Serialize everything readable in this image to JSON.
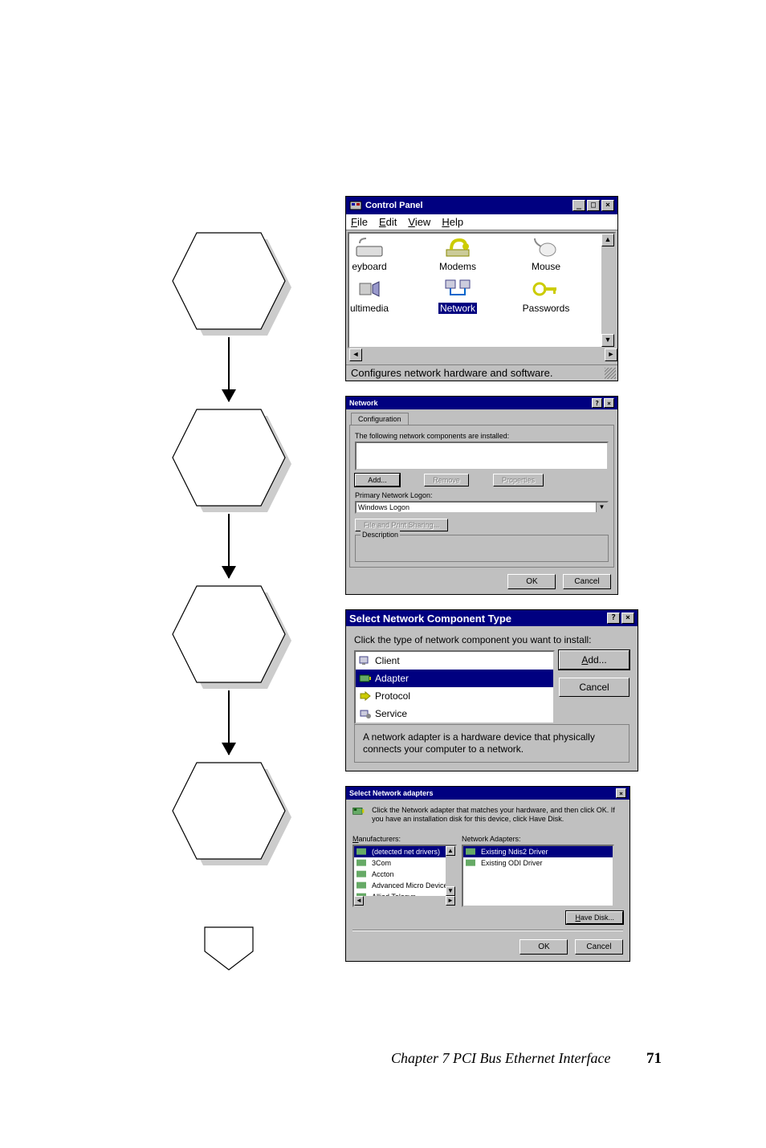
{
  "footer": {
    "chapter": "Chapter 7  PCI Bus Ethernet Interface",
    "page_number": "71"
  },
  "control_panel": {
    "title": "Control Panel",
    "menu": {
      "file": "File",
      "edit": "Edit",
      "view": "View",
      "help": "Help"
    },
    "items": {
      "keyboard": "eyboard",
      "modems": "Modems",
      "mouse": "Mouse",
      "multimedia": "ultimedia",
      "network": "Network",
      "passwords": "Passwords"
    },
    "status": "Configures network hardware and software."
  },
  "network_dialog": {
    "title": "Network",
    "tab": "Configuration",
    "list_label": "The following network components are installed:",
    "add": "Add...",
    "remove": "Remove",
    "properties": "Properties",
    "primary_label": "Primary Network Logon:",
    "primary_value": "Windows Logon",
    "file_print": "File and Print Sharing...",
    "desc_label": "Description",
    "ok": "OK",
    "cancel": "Cancel"
  },
  "select_component": {
    "title": "Select Network Component Type",
    "prompt": "Click the type of network component you want to install:",
    "items": {
      "client": "Client",
      "adapter": "Adapter",
      "protocol": "Protocol",
      "service": "Service"
    },
    "add": "Add...",
    "cancel": "Cancel",
    "desc": "A network adapter is a hardware device that physically connects your computer to a network."
  },
  "select_adapter": {
    "title": "Select Network adapters",
    "intro": "Click the Network adapter that matches your hardware, and then click OK. If you have an installation disk for this device, click Have Disk.",
    "manufacturers_label": "Manufacturers:",
    "adapters_label": "Network Adapters:",
    "manufacturers": {
      "m0": "(detected net drivers)",
      "m1": "3Com",
      "m2": "Accton",
      "m3": "Advanced Micro Device",
      "m4": "Allied Telesyn"
    },
    "adapters": {
      "a0": "Existing Ndis2 Driver",
      "a1": "Existing ODI Driver"
    },
    "have_disk": "Have Disk...",
    "ok": "OK",
    "cancel": "Cancel"
  }
}
